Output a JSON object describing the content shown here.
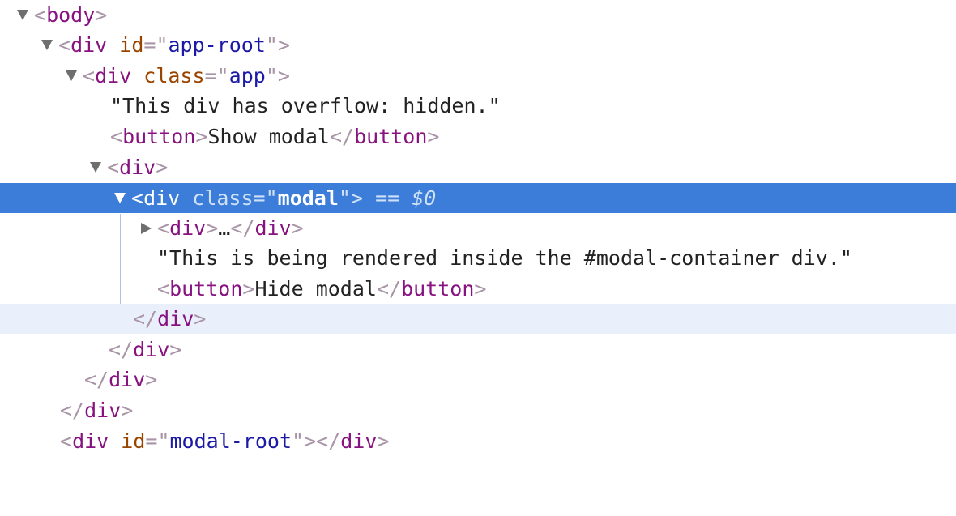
{
  "colors": {
    "selected_bg": "#3b7dd8",
    "hover_bg": "#e9f0fb",
    "tag_name": "#881280",
    "attr_name": "#994500",
    "attr_value": "#1a1aa6",
    "punctuation": "#a894a6",
    "text": "#222222"
  },
  "tree": {
    "body_open": {
      "lt": "<",
      "tag": "body",
      "gt": ">"
    },
    "app_root_open": {
      "lt": "<",
      "tag": "div",
      "attr": "id",
      "eq": "=\"",
      "val": "app-root",
      "close": "\">"
    },
    "app_open": {
      "lt": "<",
      "tag": "div",
      "attr": "class",
      "eq": "=\"",
      "val": "app",
      "close": "\">"
    },
    "text_overflow": "\"This div has overflow: hidden.\"",
    "show_button": {
      "lt": "<",
      "tag": "button",
      "gt": ">",
      "text": "Show modal",
      "lt_close": "</",
      "tag_close": "button",
      "gt_close": ">"
    },
    "div_open": {
      "lt": "<",
      "tag": "div",
      "gt": ">"
    },
    "modal_open": {
      "lt": "<",
      "tag": "div",
      "attr": "class",
      "eq": "=\"",
      "val": "modal",
      "close": "\">",
      "marker": " == ",
      "dollar": "$0"
    },
    "collapsed_div": {
      "lt": "<",
      "tag": "div",
      "gt": ">",
      "ellipsis": "…",
      "lt_close": "</",
      "tag_close": "div",
      "gt_close": ">"
    },
    "text_rendered": "\"This is being rendered inside the #modal-container div.\"",
    "hide_button": {
      "lt": "<",
      "tag": "button",
      "gt": ">",
      "text": "Hide modal",
      "lt_close": "</",
      "tag_close": "button",
      "gt_close": ">"
    },
    "close_div_1": {
      "lt": "</",
      "tag": "div",
      "gt": ">"
    },
    "close_div_2": {
      "lt": "</",
      "tag": "div",
      "gt": ">"
    },
    "close_div_3": {
      "lt": "</",
      "tag": "div",
      "gt": ">"
    },
    "close_div_4": {
      "lt": "</",
      "tag": "div",
      "gt": ">"
    },
    "modal_root": {
      "lt": "<",
      "tag": "div",
      "attr": "id",
      "eq": "=\"",
      "val": "modal-root",
      "close": "\">",
      "lt_close": "</",
      "tag_close": "div",
      "gt_close": ">"
    }
  },
  "icons": {
    "expanded": "triangle-down-icon",
    "collapsed": "triangle-right-icon"
  }
}
